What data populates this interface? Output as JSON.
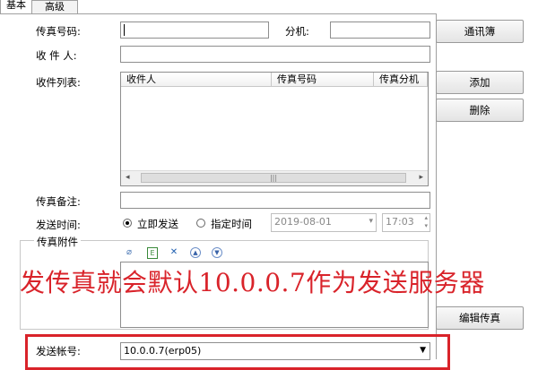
{
  "tabs": [
    "基本",
    "高级"
  ],
  "form": {
    "fax_label": "传真号码:",
    "ext_label": "分机:",
    "recipient_label": "收 件 人:",
    "list_label": "收件列表:",
    "note_label": "传真备注:",
    "time_label": "发送时间:",
    "attach_label": "传真附件",
    "account_label": "发送帐号:"
  },
  "list": {
    "columns": [
      "收件人",
      "传真号码",
      "传真分机"
    ]
  },
  "schedule": {
    "now_label": "立即发送",
    "specified_label": "指定时间",
    "date": "2019-08-01",
    "time": "17:03"
  },
  "buttons": {
    "address_book": "通讯簿",
    "add": "添加",
    "delete": "删除",
    "edit_fax": "编辑传真"
  },
  "account": {
    "value": "10.0.0.7(erp05)"
  },
  "overlay": {
    "caption": "发传真就会默认10.0.0.7作为发送服务器"
  },
  "colors": {
    "annotation": "#d9232a"
  }
}
